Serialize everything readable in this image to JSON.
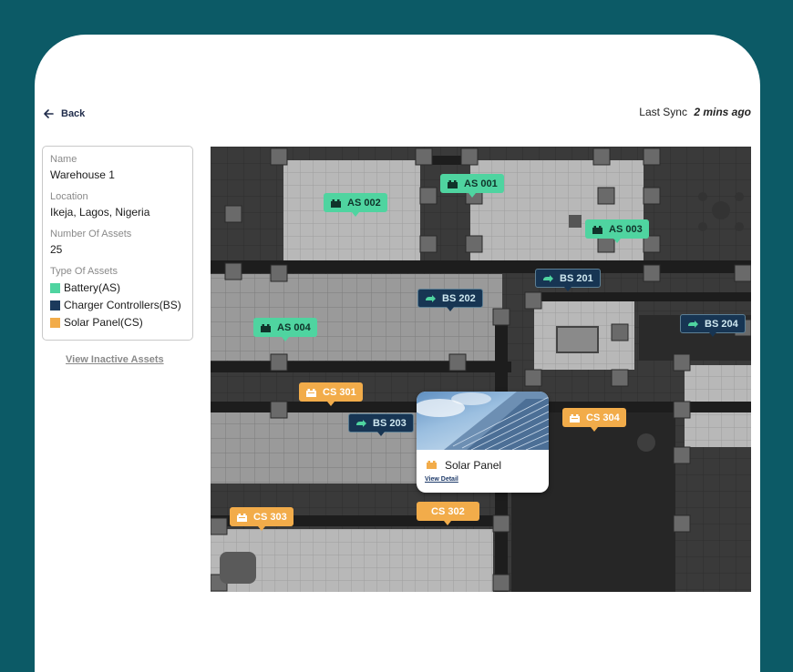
{
  "header": {
    "back_label": "Back",
    "sync_label": "Last Sync",
    "sync_value": "2 mins ago"
  },
  "warehouse": {
    "name_label": "Name",
    "name_value": "Warehouse 1",
    "location_label": "Location",
    "location_value": "Ikeja, Lagos, Nigeria",
    "count_label": "Number Of Assets",
    "count_value": "25",
    "types_label": "Type Of Assets",
    "types": [
      {
        "label": "Battery(AS)",
        "color": "#4fd4a0"
      },
      {
        "label": "Charger Controllers(BS)",
        "color": "#1b3a5c"
      },
      {
        "label": "Solar Panel(CS)",
        "color": "#f2ac4a"
      }
    ]
  },
  "view_inactive_label": "View Inactive Assets",
  "markers": [
    {
      "label": "AS 001",
      "type": "battery"
    },
    {
      "label": "AS 002",
      "type": "battery"
    },
    {
      "label": "AS 003",
      "type": "battery"
    },
    {
      "label": "AS 004",
      "type": "battery"
    },
    {
      "label": "BS 201",
      "type": "charger"
    },
    {
      "label": "BS 202",
      "type": "charger"
    },
    {
      "label": "BS 203",
      "type": "charger"
    },
    {
      "label": "BS 204",
      "type": "charger"
    },
    {
      "label": "CS 301",
      "type": "solar"
    },
    {
      "label": "CS 302",
      "type": "solar"
    },
    {
      "label": "CS 303",
      "type": "solar"
    },
    {
      "label": "CS 304",
      "type": "solar"
    }
  ],
  "popup": {
    "title": "Solar Panel",
    "link_label": "View Detail"
  }
}
